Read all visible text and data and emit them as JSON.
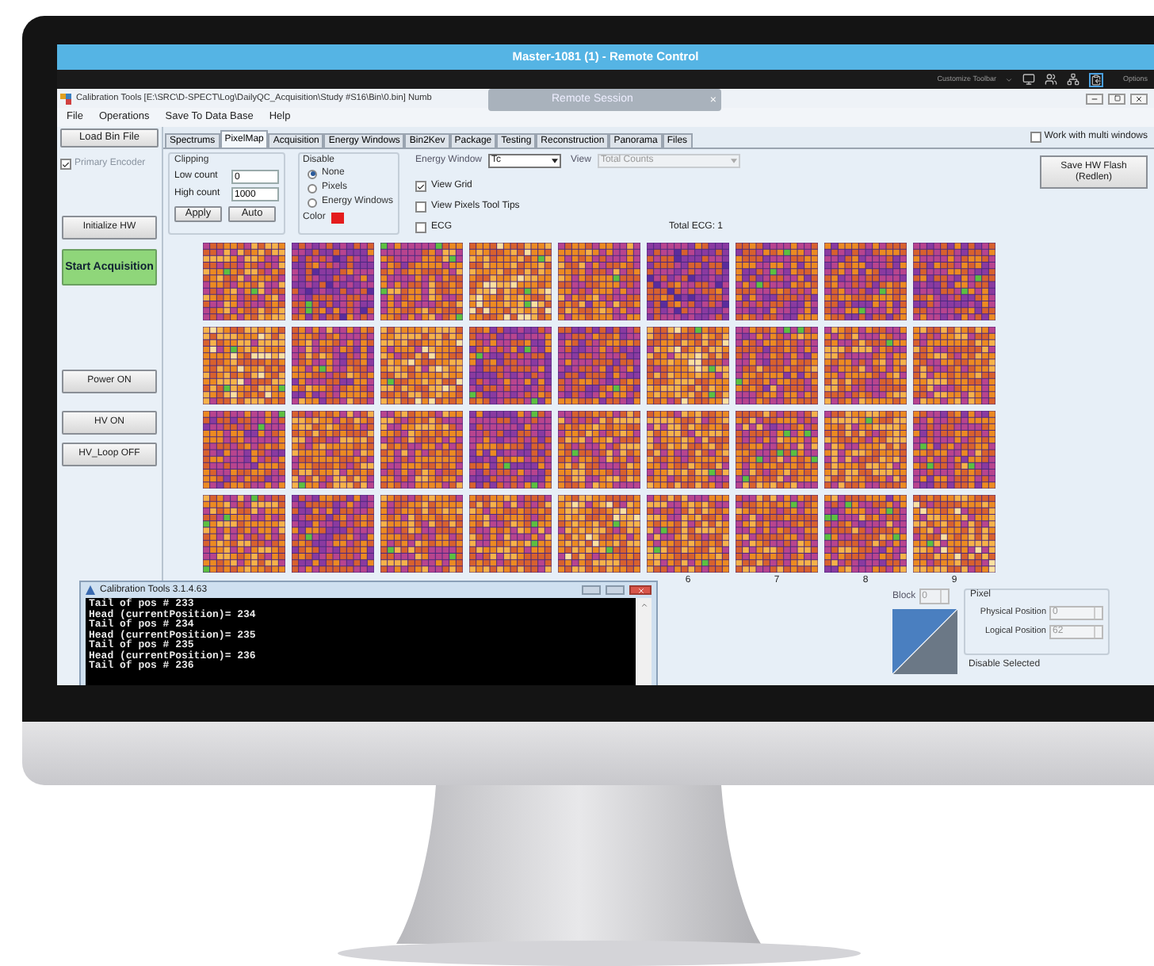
{
  "remote_window": {
    "title": "Master-1081 (1) - Remote Control",
    "customize": "Customize Toolbar",
    "options": "Options"
  },
  "app": {
    "title": "Calibration Tools [E:\\SRC\\D-SPECT\\Log\\DailyQC_Acquisition\\Study #S16\\Bin\\0.bin] Numb",
    "overlay": {
      "title": "Remote Session",
      "close": "×"
    }
  },
  "menu": [
    "File",
    "Operations",
    "Save To Data Base",
    "Help"
  ],
  "load_button": "Load Bin File",
  "tabs": [
    {
      "label": "Spectrums",
      "selected": false
    },
    {
      "label": "PixelMap",
      "selected": true
    },
    {
      "label": "Acquisition",
      "selected": false
    },
    {
      "label": "Energy Windows",
      "selected": false
    },
    {
      "label": "Bin2Kev",
      "selected": false
    },
    {
      "label": "Package",
      "selected": false
    },
    {
      "label": "Testing",
      "selected": false
    },
    {
      "label": "Reconstruction",
      "selected": false
    },
    {
      "label": "Panorama",
      "selected": false
    },
    {
      "label": "Files",
      "selected": false
    }
  ],
  "multi_windows": {
    "label": "Work with multi windows",
    "checked": false
  },
  "primary_encoder": {
    "label": "Primary Encoder",
    "checked": true
  },
  "left_buttons": [
    {
      "label": "Initialize HW",
      "kind": "normal"
    },
    {
      "label": "Start Acquisition",
      "kind": "primary"
    },
    {
      "label": "Power ON",
      "kind": "normal"
    },
    {
      "label": "HV ON",
      "kind": "normal"
    },
    {
      "label": "HV_Loop OFF",
      "kind": "normal"
    }
  ],
  "clipping": {
    "title": "Clipping",
    "fields": [
      {
        "label": "Low count",
        "value": "0"
      },
      {
        "label": "High count",
        "value": "1000"
      }
    ],
    "buttons": [
      "Apply",
      "Auto"
    ]
  },
  "disable": {
    "title": "Disable",
    "options": [
      {
        "label": "None",
        "selected": true
      },
      {
        "label": "Pixels",
        "selected": false
      },
      {
        "label": "Energy Windows",
        "selected": false
      }
    ],
    "color_label": "Color"
  },
  "energy_window": {
    "label": "Energy Window",
    "value": "Tc"
  },
  "view": {
    "label": "View",
    "value": "Total Counts",
    "disabled": true
  },
  "options": [
    {
      "label": "View Grid",
      "checked": true
    },
    {
      "label": "View Pixels Tool Tips",
      "checked": false
    },
    {
      "label": "ECG",
      "checked": false
    }
  ],
  "total_ecg": "Total ECG: 1",
  "save_flash": {
    "lines": [
      "Save HW Flash",
      "(Redlen)"
    ]
  },
  "column_labels": [
    "6",
    "7",
    "8",
    "9"
  ],
  "block": {
    "label": "Block",
    "value": "0"
  },
  "pixel": {
    "title": "Pixel",
    "fields": [
      {
        "label": "Physical Position",
        "value": "0"
      },
      {
        "label": "Logical Position",
        "value": "62"
      }
    ]
  },
  "disable_selected": "Disable Selected",
  "console": {
    "title": "Calibration Tools 3.1.4.63",
    "lines": [
      "Tail of pos # 233",
      "Head (currentPosition)= 234",
      "Tail of pos # 234",
      "Head (currentPosition)= 235",
      "Tail of pos # 235",
      "Head (currentPosition)= 236",
      "Tail of pos # 236"
    ]
  }
}
